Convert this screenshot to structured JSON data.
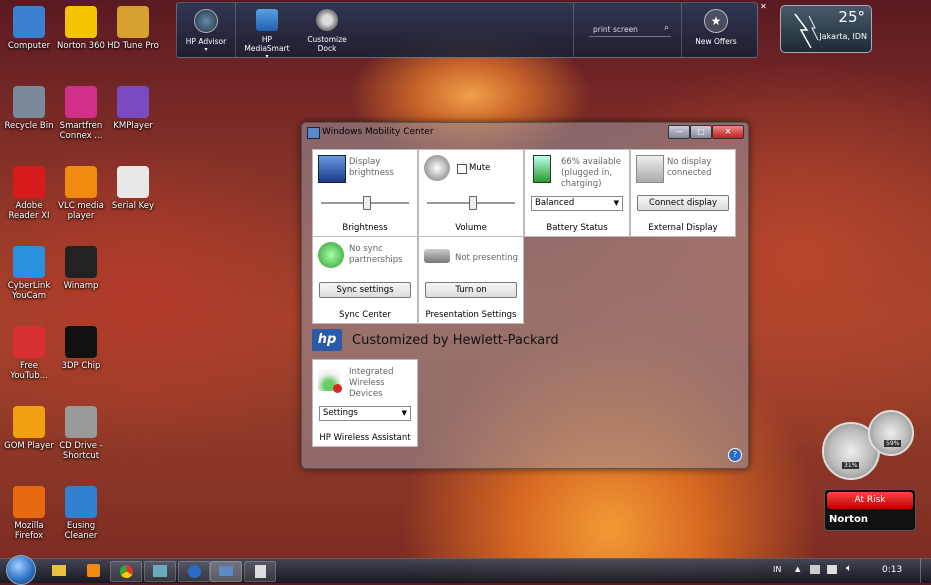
{
  "desktop_icons": [
    {
      "label": "Computer",
      "color": "#3a7fd0"
    },
    {
      "label": "Norton 360",
      "color": "#f5c400"
    },
    {
      "label": "HD Tune Pro",
      "color": "#d8a030"
    },
    {
      "label": "Recycle Bin",
      "color": "#7a8a9a"
    },
    {
      "label": "Smartfren Connex ...",
      "color": "#d0308a"
    },
    {
      "label": "KMPlayer",
      "color": "#7a4ac0"
    },
    {
      "label": "Adobe Reader XI",
      "color": "#d81a1a"
    },
    {
      "label": "VLC media player",
      "color": "#f08a10"
    },
    {
      "label": "Serial Key",
      "color": "#e8e8e8"
    },
    {
      "label": "CyberLink YouCam",
      "color": "#2a90e0"
    },
    {
      "label": "Winamp",
      "color": "#222222"
    },
    {
      "label": "Free YouTub...",
      "color": "#d83030"
    },
    {
      "label": "3DP Chip",
      "color": "#111111"
    },
    {
      "label": "GOM Player",
      "color": "#f0a010"
    },
    {
      "label": "CD Drive - Shortcut",
      "color": "#999999"
    },
    {
      "label": "Mozilla Firefox",
      "color": "#e86a10"
    },
    {
      "label": "Eusing Cleaner",
      "color": "#3080d0"
    }
  ],
  "dock": {
    "items": [
      "HP Advisor",
      "HP MediaSmart",
      "Customize Dock"
    ],
    "search_text": "print screen",
    "offers": "New Offers"
  },
  "weather": {
    "temp": "25°",
    "city": "Jakarta, IDN"
  },
  "window": {
    "title": "Windows Mobility Center",
    "min": "—",
    "max": "□",
    "close": "✕",
    "brightness": {
      "status": "Display brightness",
      "label": "Brightness"
    },
    "volume": {
      "mute": "Mute",
      "label": "Volume"
    },
    "battery": {
      "status": "66% available (plugged in, charging)",
      "plan": "Balanced",
      "label": "Battery Status"
    },
    "display": {
      "status": "No display connected",
      "button": "Connect display",
      "label": "External Display"
    },
    "sync": {
      "status": "No sync partnerships",
      "button": "Sync settings",
      "label": "Sync Center"
    },
    "presentation": {
      "status": "Not presenting",
      "button": "Turn on",
      "label": "Presentation Settings"
    },
    "oem_banner": "Customized by Hewlett-Packard",
    "oem_logo": "hp",
    "wireless": {
      "status": "Integrated Wireless Devices",
      "select": "Settings",
      "label": "HP Wireless Assistant"
    },
    "help": "?"
  },
  "gadgets": {
    "cpu": "31%",
    "mem": "59%"
  },
  "norton_widget": {
    "status": "At Risk",
    "brand": "Norton"
  },
  "tray": {
    "lang": "IN",
    "clock": "0:13"
  }
}
